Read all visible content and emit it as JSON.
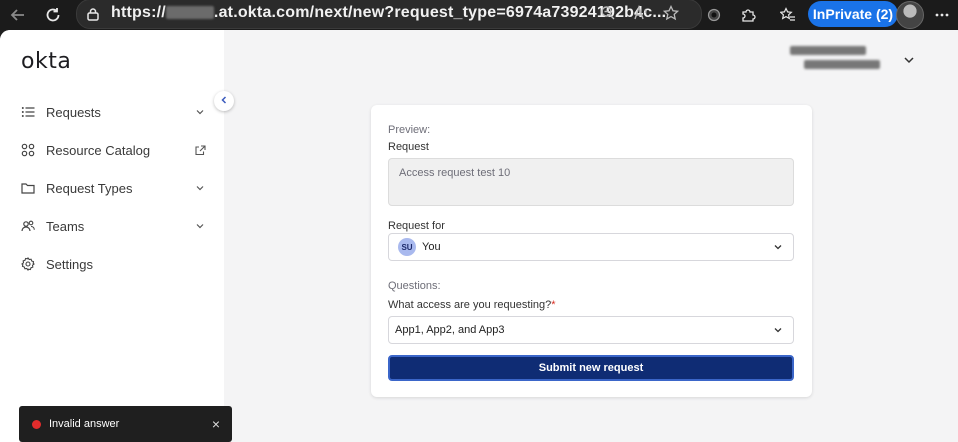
{
  "browser": {
    "url_prefix": "https://",
    "url_suffix": ".at.okta.com/next/new?request_type=6974a73924192b4c...",
    "inprivate_label": "InPrivate (2)"
  },
  "sidebar": {
    "logo": "okta",
    "items": [
      {
        "label": "Requests"
      },
      {
        "label": "Resource Catalog"
      },
      {
        "label": "Request Types"
      },
      {
        "label": "Teams"
      },
      {
        "label": "Settings"
      }
    ]
  },
  "form": {
    "preview_label": "Preview:",
    "request_label": "Request",
    "request_value": "Access request test 10",
    "request_for_label": "Request for",
    "request_for_initials": "SU",
    "request_for_value": "You",
    "questions_label": "Questions:",
    "question_text": "What access are you requesting?",
    "question_required_marker": "*",
    "answer_value": "App1,  App2, and App3",
    "submit_label": "Submit new request"
  },
  "toast": {
    "message": "Invalid answer",
    "close_glyph": "×",
    "status_color": "#e22c2c"
  },
  "colors": {
    "primary_button": "#0f2c74",
    "browser_accent": "#1a73e8"
  }
}
